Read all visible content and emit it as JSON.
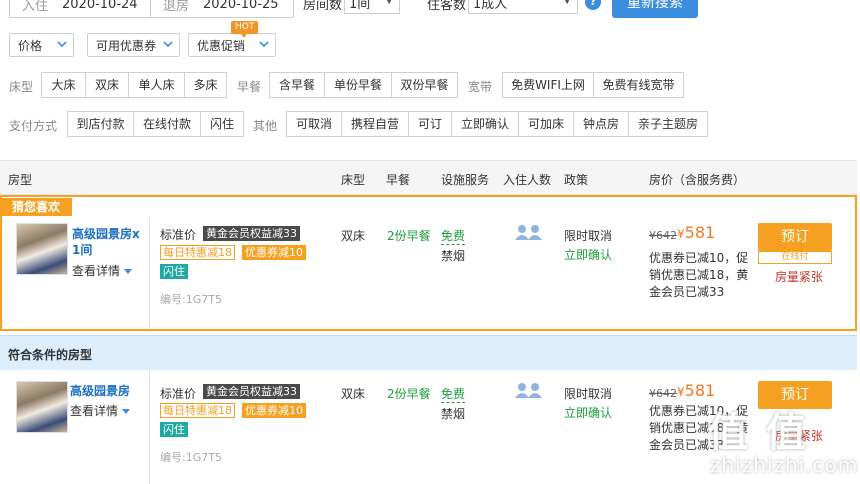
{
  "search": {
    "checkin_label": "入住",
    "checkin_value": "2020-10-24",
    "checkout_label": "退房",
    "checkout_value": "2020-10-25",
    "rooms_label": "房间数",
    "rooms_value": "1间",
    "guests_label": "住客数",
    "guests_value": "1成人",
    "help_icon": "?",
    "search_button": "重新搜索"
  },
  "dropdowns": {
    "price": "价格",
    "coupons": "可用优惠券",
    "promo": "优惠促销",
    "hot_badge": "HOT"
  },
  "filters": {
    "bed_label": "床型",
    "bed_options": [
      "大床",
      "双床",
      "单人床",
      "多床"
    ],
    "breakfast_label": "早餐",
    "breakfast_options": [
      "含早餐",
      "单份早餐",
      "双份早餐"
    ],
    "broadband_label": "宽带",
    "broadband_options": [
      "免费WIFI上网",
      "免费有线宽带"
    ],
    "payment_label": "支付方式",
    "payment_options": [
      "到店付款",
      "在线付款",
      "闪住"
    ],
    "other_label": "其他",
    "other_options": [
      "可取消",
      "携程自营",
      "可订",
      "立即确认",
      "可加床",
      "钟点房",
      "亲子主题房"
    ]
  },
  "table_header": {
    "room_type": "房型",
    "bed_type": "床型",
    "breakfast": "早餐",
    "facilities": "设施服务",
    "occupancy": "入住人数",
    "policy": "政策",
    "price": "房价（含服务费）"
  },
  "featured": {
    "badge": "猜您喜欢",
    "room_name_line1": "高级园景房x",
    "room_name_line2": "1间",
    "details": "查看详情",
    "price_type": "标准价",
    "tag_gold": "黄金会员权益减33",
    "tag_daily": "每日特惠减18",
    "tag_coupon": "优惠券减10",
    "tag_flash": "闪住",
    "code": "编号:1G7T5",
    "bed": "双床",
    "breakfast": "2份早餐",
    "facility_free": "免费",
    "facility_nosmoke": "禁烟",
    "policy_cancel": "限时取消",
    "policy_confirm": "立即确认",
    "price_old": "¥642",
    "price_currency": "¥",
    "price_new": "581",
    "price_desc": "优惠券已减10，促销优惠已减18，黄金会员已减33",
    "book": "预订",
    "online_pay": "在线付",
    "tight": "房量紧张"
  },
  "section_title": "符合条件的房型",
  "room2": {
    "room_name": "高级园景房",
    "details": "查看详情",
    "price_type": "标准价",
    "tag_gold": "黄金会员权益减33",
    "tag_daily": "每日特惠减18",
    "tag_coupon": "优惠券减10",
    "tag_flash": "闪住",
    "code": "编号:1G7T5",
    "bed": "双床",
    "breakfast": "2份早餐",
    "facility_free": "免费",
    "facility_nosmoke": "禁烟",
    "policy_cancel": "限时取消",
    "policy_confirm": "立即确认",
    "price_old": "¥642",
    "price_currency": "¥",
    "price_new": "581",
    "price_desc": "优惠券已减10，促销优惠已减18，黄金会员已减33",
    "book": "预订",
    "tight": "房量紧张"
  },
  "watermark": {
    "logo": "值 值",
    "site": "zhizhizhi.com"
  },
  "colors": {
    "accent_blue": "#3b8de0",
    "accent_orange": "#f5a020",
    "price_orange": "#f5771f",
    "green": "#1a9e3a",
    "section_bg": "#ddeefc"
  }
}
